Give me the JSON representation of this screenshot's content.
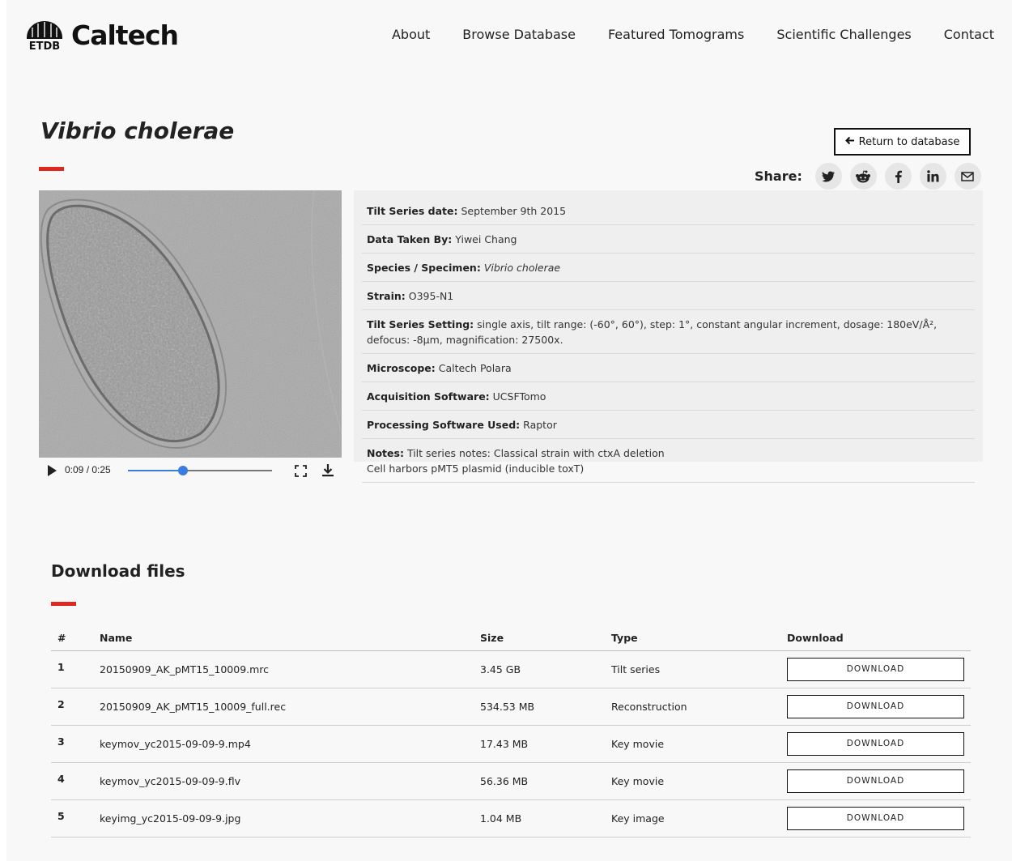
{
  "header": {
    "logo_text": "Caltech",
    "logo_badge": "ETDB",
    "nav": [
      "About",
      "Browse Database",
      "Featured Tomograms",
      "Scientific Challenges",
      "Contact"
    ]
  },
  "page": {
    "title": "Vibrio cholerae",
    "return_label": "Return to database",
    "share_label": "Share:",
    "share_icons": [
      "twitter-icon",
      "reddit-icon",
      "facebook-icon",
      "linkedin-icon",
      "email-icon"
    ]
  },
  "video": {
    "time": "0:09 / 0:25",
    "progress": 0.38
  },
  "metadata": [
    {
      "label": "Tilt Series date:",
      "value": "September 9th 2015"
    },
    {
      "label": "Data Taken By:",
      "value": "Yiwei Chang"
    },
    {
      "label": "Species / Specimen:",
      "value": "Vibrio cholerae"
    },
    {
      "label": "Strain:",
      "value": "O395-N1"
    },
    {
      "label": "Tilt Series Setting:",
      "value": "single axis, tilt range: (-60°, 60°), step: 1°, constant angular increment, dosage: 180eV/Å², defocus: -8μm, magnification: 27500x."
    },
    {
      "label": "Microscope:",
      "value": "Caltech Polara"
    },
    {
      "label": "Acquisition Software:",
      "value": "UCSFTomo"
    },
    {
      "label": "Processing Software Used:",
      "value": "Raptor"
    },
    {
      "label": "Notes:",
      "value": "Tilt series notes: Classical strain with ctxA deletion",
      "value2": "Cell harbors pMT5 plasmid (inducible toxT)"
    }
  ],
  "downloads": {
    "title": "Download files",
    "headers": [
      "#",
      "Name",
      "Size",
      "Type",
      "Download"
    ],
    "button_label": "DOWNLOAD",
    "rows": [
      {
        "num": "1",
        "name": "20150909_AK_pMT15_10009.mrc",
        "size": "3.45 GB",
        "type": "Tilt series"
      },
      {
        "num": "2",
        "name": "20150909_AK_pMT15_10009_full.rec",
        "size": "534.53 MB",
        "type": "Reconstruction"
      },
      {
        "num": "3",
        "name": "keymov_yc2015-09-09-9.mp4",
        "size": "17.43 MB",
        "type": "Key movie"
      },
      {
        "num": "4",
        "name": "keymov_yc2015-09-09-9.flv",
        "size": "56.36 MB",
        "type": "Key movie"
      },
      {
        "num": "5",
        "name": "keyimg_yc2015-09-09-9.jpg",
        "size": "1.04 MB",
        "type": "Key image"
      }
    ]
  }
}
